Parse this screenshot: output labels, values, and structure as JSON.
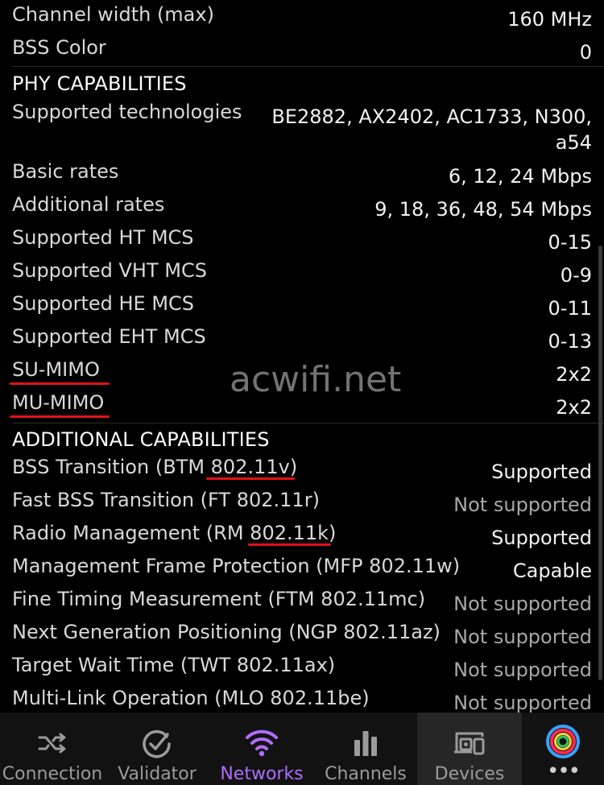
{
  "rows_top": [
    {
      "label": "Channel width (max)",
      "value": "160 MHz"
    },
    {
      "label": "BSS Color",
      "value": "0"
    }
  ],
  "phy": {
    "title": "PHY CAPABILITIES",
    "supported_technologies": {
      "label": "Supported technologies",
      "value": "BE2882, AX2402, AC1733, N300, a54"
    },
    "rows": [
      {
        "label": "Basic rates",
        "value": "6, 12, 24 Mbps"
      },
      {
        "label": "Additional rates",
        "value": "9, 18, 36, 48, 54 Mbps"
      },
      {
        "label": "Supported HT MCS",
        "value": "0-15"
      },
      {
        "label": "Supported VHT MCS",
        "value": "0-9"
      },
      {
        "label": "Supported HE MCS",
        "value": "0-11"
      },
      {
        "label": "Supported EHT MCS",
        "value": "0-13"
      },
      {
        "label": "SU-MIMO",
        "value": "2x2"
      },
      {
        "label": "MU-MIMO",
        "value": "2x2"
      }
    ]
  },
  "watermark": "acwifi.net",
  "additional": {
    "title": "ADDITIONAL CAPABILITIES",
    "rows": [
      {
        "label": "BSS Transition (BTM 802.11v)",
        "value": "Supported"
      },
      {
        "label": "Fast BSS Transition (FT 802.11r)",
        "value": "Not supported"
      },
      {
        "label": "Radio Management (RM 802.11k)",
        "value": "Supported"
      },
      {
        "label": "Management Frame Protection (MFP 802.11w)",
        "value": "Capable"
      },
      {
        "label": "Fine Timing Measurement (FTM 802.11mc)",
        "value": "Not supported"
      },
      {
        "label": "Next Generation Positioning (NGP 802.11az)",
        "value": "Not supported"
      },
      {
        "label": "Target Wait Time (TWT 802.11ax)",
        "value": "Not supported"
      },
      {
        "label": "Multi-Link Operation (MLO 802.11be)",
        "value": "Not supported"
      }
    ]
  },
  "nav": {
    "items": [
      {
        "label": "Connection",
        "icon": "connection-shuffle-icon"
      },
      {
        "label": "Validator",
        "icon": "validator-check-icon"
      },
      {
        "label": "Networks",
        "icon": "wifi-icon"
      },
      {
        "label": "Channels",
        "icon": "bar-chart-icon"
      },
      {
        "label": "Devices",
        "icon": "devices-icon"
      },
      {
        "label": "•••",
        "icon": "app-logo-icon"
      }
    ],
    "active_index": 2,
    "selected_bg_index": 4
  },
  "colors": {
    "accent": "#b06cff",
    "underline": "#e0121a",
    "background": "#000000"
  }
}
